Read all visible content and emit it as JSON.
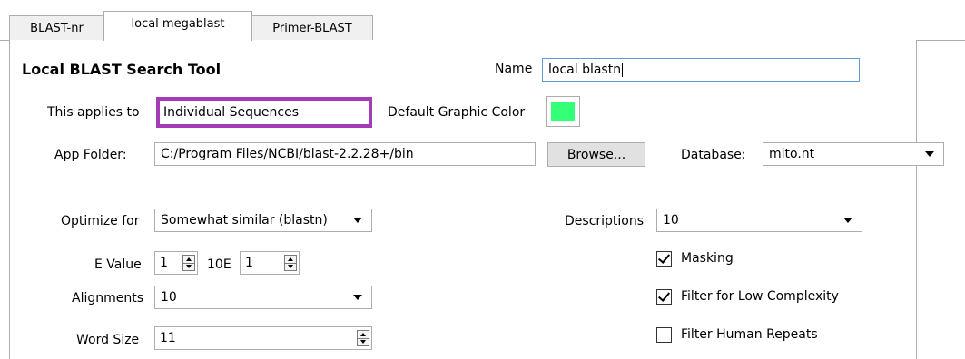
{
  "tabs": [
    {
      "label": "BLAST-nr",
      "active": false
    },
    {
      "label": "local megablast",
      "active": true
    },
    {
      "label": "Primer-BLAST",
      "active": false
    }
  ],
  "form": {
    "title": "Local BLAST Search Tool",
    "name_label": "Name",
    "name_value": "local blastn",
    "applies_label": "This applies to",
    "applies_value": "Individual Sequences",
    "color_label": "Default Graphic Color",
    "color_value": "#33ff77",
    "app_folder_label": "App Folder:",
    "app_folder_value": "C:/Program Files/NCBI/blast-2.2.28+/bin",
    "browse_label": "Browse...",
    "database_label": "Database:",
    "database_value": "mito.nt",
    "optimize_label": "Optimize for",
    "optimize_value": "Somewhat similar (blastn)",
    "evalue_label": "E Value",
    "evalue_value": "1",
    "exp_label": "10E",
    "exp_value": "1",
    "alignments_label": "Alignments",
    "alignments_value": "10",
    "wordsize_label": "Word Size",
    "wordsize_value": "11",
    "descriptions_label": "Descriptions",
    "descriptions_value": "10",
    "masking_label": "Masking",
    "masking_checked": true,
    "lowcomplexity_label": "Filter for Low Complexity",
    "lowcomplexity_checked": true,
    "humanrepeats_label": "Filter Human Repeats",
    "humanrepeats_checked": false
  }
}
